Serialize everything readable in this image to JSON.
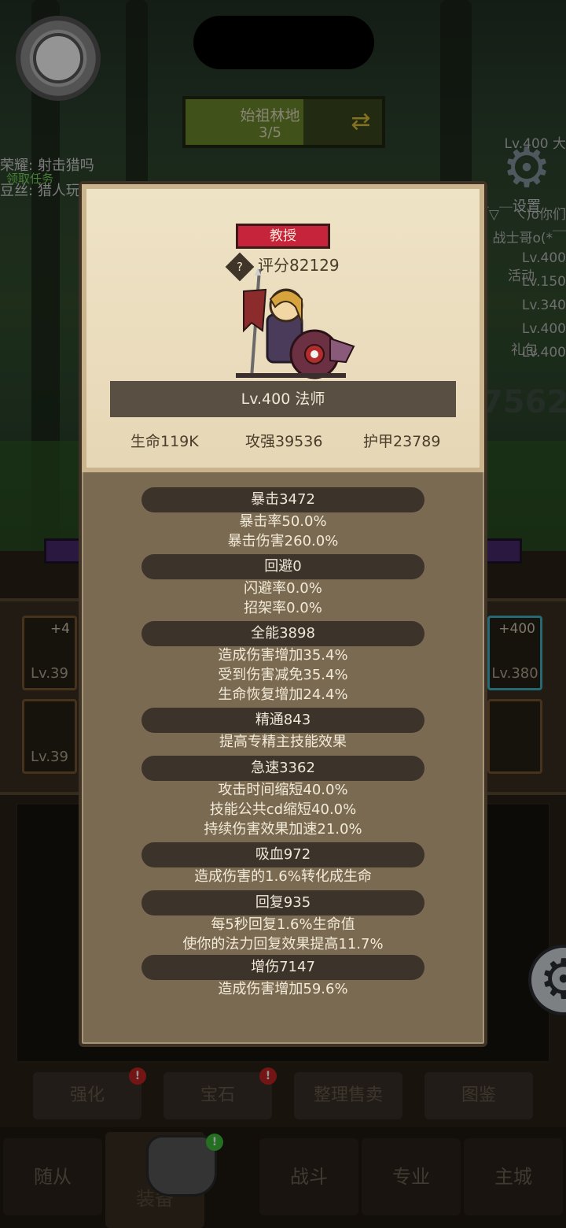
{
  "status": {
    "camera_notch": ""
  },
  "zone": {
    "name": "始祖林地",
    "progress_text": "3/5",
    "progress": 0.6
  },
  "chat": [
    {
      "prefix": "荣耀:",
      "text": "射击猎吗"
    },
    {
      "prefix": "领取任务",
      "text": ""
    },
    {
      "prefix": "豆丝:",
      "text": "猎人玩"
    }
  ],
  "settings": {
    "label": "设置"
  },
  "right_side": {
    "lv_top": "Lv.400 大",
    "chat_1": "ㄟ(￣▽￣ㄟ)o你们",
    "chat_2": "战士哥o(*￣",
    "activity": "活动",
    "gift": "礼包",
    "lv_lines": [
      "Lv.400",
      "Lv.150",
      "Lv.340",
      "Lv.400",
      "Lv.400"
    ],
    "big_number": "7562"
  },
  "equipment_slots": [
    {
      "level": "Lv.39",
      "plus": "+4"
    },
    {
      "level": "Lv.39",
      "plus": ""
    },
    {
      "level": "Lv.380",
      "plus": "+400"
    },
    {
      "level": "",
      "plus": ""
    }
  ],
  "bottom_buttons": [
    "强化",
    "宝石",
    "整理售卖",
    "图鉴"
  ],
  "nav": {
    "items": [
      "随从",
      "装备",
      "战斗",
      "专业",
      "主城"
    ],
    "active": "装备"
  },
  "hero": {
    "title": "教授",
    "score_label": "评分82129",
    "name": "Lv.400 法师",
    "hp": "生命119K",
    "attack": "攻强39536",
    "armor": "护甲23789"
  },
  "sections": [
    {
      "header": "暴击3472",
      "lines": [
        "暴击率50.0%",
        "暴击伤害260.0%"
      ]
    },
    {
      "header": "回避0",
      "lines": [
        "闪避率0.0%",
        "招架率0.0%"
      ]
    },
    {
      "header": "全能3898",
      "lines": [
        "造成伤害增加35.4%",
        "受到伤害减免35.4%",
        "生命恢复增加24.4%"
      ]
    },
    {
      "header": "精通843",
      "lines": [
        "提高专精主技能效果"
      ]
    },
    {
      "header": "急速3362",
      "lines": [
        "攻击时间缩短40.0%",
        "技能公共cd缩短40.0%",
        "持续伤害效果加速21.0%"
      ]
    },
    {
      "header": "吸血972",
      "lines": [
        "造成伤害的1.6%转化成生命"
      ]
    },
    {
      "header": "回复935",
      "lines": [
        "每5秒回复1.6%生命值",
        "使你的法力回复效果提高11.7%"
      ]
    },
    {
      "header": "增伤7147",
      "lines": [
        "造成伤害增加59.6%"
      ]
    }
  ]
}
